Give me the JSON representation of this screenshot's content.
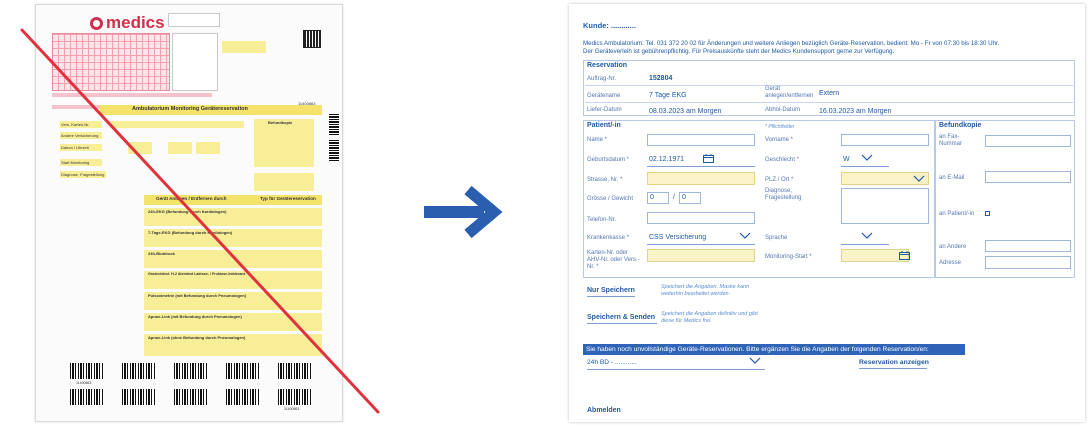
{
  "paper_form": {
    "logo": "medics",
    "title": "Ambulatorium Monitoring Gerätereservation",
    "section_device": "Gerät Anlegen / Entfernen durch",
    "section_device_right": "Typ für Gerätereservation",
    "befundkopie": "Befundkopie",
    "order_number": "11400863",
    "left_labels": [
      "Vers. Karten-Nr.",
      "Andere Versicherung",
      "Datum / Uhrzeit",
      "Start Monitoring",
      "Diagnose, Fragestellung"
    ],
    "device_rows": [
      "24h-EKG (Befundung durch Kardiologen)",
      "7-Tage-EKG (Befundung durch Kardiologen)",
      "24h-Blutdruck",
      "Gastrointest. H-2 Atemtest Laktose- / Fruktose-Intoleranz",
      "Pulsoximetrie (mit Befundung durch Pneumologen)",
      "Apnoe-Link (mit Befundung durch Pneumologen)",
      "Apnoe-Link (ohne Befundung durch Pneumologen)"
    ],
    "barcode_label": "11400863"
  },
  "web_form": {
    "kunde_label": "Kunde: ............",
    "info_line1": "Medics Ambulatorium: Tel. 031 372 20 02 für Änderungen und weitere Anliegen bezüglich Geräte-Reservation, bedient: Mo - Fr von 07:30 bis 18:30 Uhr.",
    "info_line2": "Der Geräteverleih ist gebührenpflichtig. Für Preisauskünfte steht der Medics Kundensupport gerne zur Verfügung.",
    "reservation": {
      "heading": "Reservation",
      "auftrag_label": "Auftrag-Nr.",
      "auftrag_value": "152804",
      "geraetename_label": "Gerätename",
      "geraetename_value": "7 Tage EKG",
      "geraet_anlegen_label": "Gerät anlegen/entfernen",
      "geraet_anlegen_value": "Extern",
      "liefer_label": "Liefer-Datum",
      "liefer_value": "08.03.2023 am Morgen",
      "abhol_label": "Abhol-Datum",
      "abhol_value": "16.03.2023 am Morgen"
    },
    "patient": {
      "heading": "Patient/-in",
      "pflicht_hint": "* Pflichtfelder",
      "name_label": "Name *",
      "vorname_label": "Vorname *",
      "geburtsdatum_label": "Geburtsdatum *",
      "geburtsdatum_value": "02.12.1971",
      "geschlecht_label": "Geschlecht *",
      "geschlecht_value": "W",
      "strasse_label": "Strasse, Nr. *",
      "plz_label": "PLZ / Ort *",
      "groesse_label": "Grösse / Gewicht",
      "groesse_value": "0",
      "gewicht_value": "0",
      "slash": "/",
      "diagnose_label": "Diagnose, Fragestellung",
      "telefon_label": "Telefon-Nr.",
      "krankenkasse_label": "Krankenkasse *",
      "krankenkasse_value": "CSS Versicherung",
      "sprache_label": "Sprache",
      "karten_label": "Karten-Nr. oder AHV-Nr. oder Vers.-Nr. *",
      "monitoring_label": "Monitoring-Start *"
    },
    "befundkopie": {
      "heading": "Befundkopie",
      "fax_label": "an Fax-Nummar",
      "email_label": "an E-Mail",
      "patient_label": "an Patient/-in",
      "andere_label": "an Andere",
      "adresse_label": "Adresse"
    },
    "actions": {
      "nur_speichern_label": "Nur Speichern",
      "nur_speichern_hint": "Speichert die Angaben. Maske kann weiterhin bearbeitet werden.",
      "speichern_senden_label": "Speichern & Senden",
      "speichern_senden_hint": "Speichert die Angaben definitiv und gibt diese für Medics frei."
    },
    "warning": "Sie haben noch unvollständige Geräte-Reservationen. Bitte ergänzen Sie die Angaben der folgenden Reservation/en:",
    "pending_select": "24h BD - ............",
    "reservation_anzeigen": "Reservation anzeigen",
    "abmelden": "Abmelden"
  },
  "colors": {
    "brand_blue": "#1f5aa6",
    "strike_red": "#e0323d",
    "arrow_blue": "#2a5fb0",
    "field_yellow": "#fbf3c8"
  }
}
